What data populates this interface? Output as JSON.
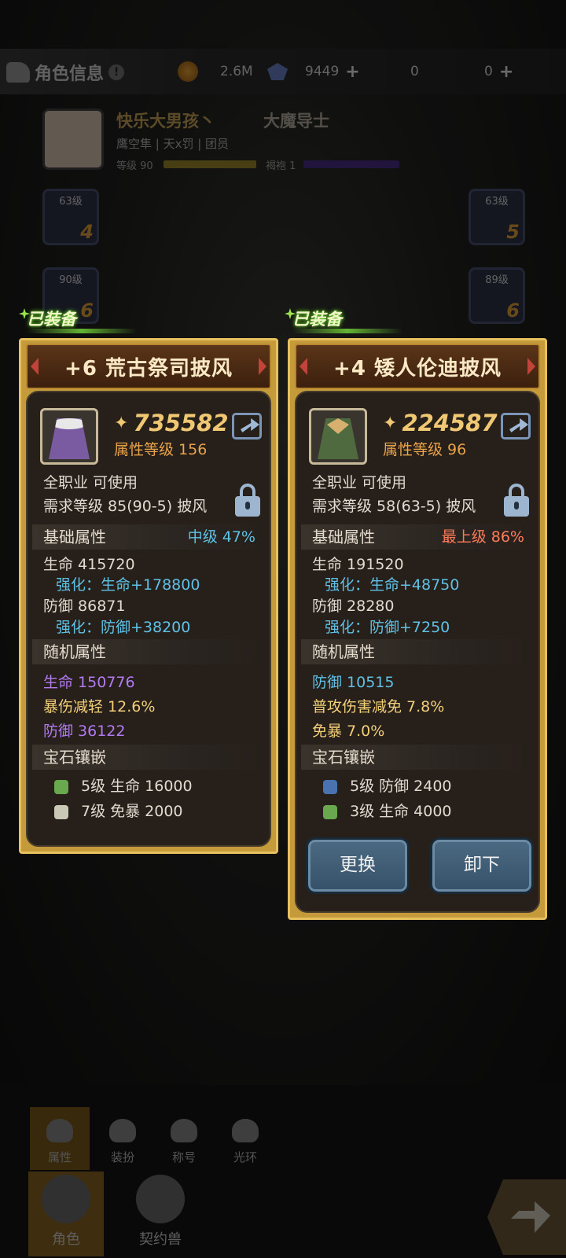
{
  "header": {
    "title": "角色信息",
    "info_mark": "!",
    "gold": "2.6M",
    "diamond": "9449",
    "ticket1": "0",
    "ticket2": "0",
    "plus": "+"
  },
  "player": {
    "name": "快乐大男孩丶",
    "class": "大魔导士",
    "title_line": "鹰空隼 | 天x罚 | 团员",
    "level_label": "等级 90",
    "cloak_label": "褐袍 1"
  },
  "slots": [
    {
      "level": "63级",
      "num": "4"
    },
    {
      "level": "90级",
      "num": "6"
    },
    {
      "level": "63级",
      "num": "5"
    },
    {
      "level": "89级",
      "num": "6"
    }
  ],
  "cards": [
    {
      "equipped_label": "已装备",
      "title": "+6 荒古祭司披风",
      "power": "735582",
      "attr_level": "属性等级 156",
      "usable": "全职业 可使用",
      "requirement": "需求等级 85(90-5)  披风",
      "base_section": "基础属性",
      "grade": "中级  47%",
      "base": [
        {
          "text": "生命  415720",
          "color": "white"
        },
        {
          "text": "强化：生命+178800",
          "color": "blue"
        },
        {
          "text": "防御  86871",
          "color": "white"
        },
        {
          "text": "强化：防御+38200",
          "color": "blue"
        }
      ],
      "random_section": "随机属性",
      "random": [
        {
          "text": "生命    150776",
          "color": "purple"
        },
        {
          "text": "暴伤减轻    12.6%",
          "color": "yellow"
        },
        {
          "text": "防御    36122",
          "color": "purple"
        }
      ],
      "gem_section": "宝石镶嵌",
      "gems": [
        {
          "text": "5级    生命 16000",
          "gem_color": "#6aa84f"
        },
        {
          "text": "7级    免暴 2000",
          "gem_color": "#c9c9b5"
        }
      ]
    },
    {
      "equipped_label": "已装备",
      "title": "+4 矮人伦迪披风",
      "power": "224587",
      "attr_level": "属性等级 96",
      "usable": "全职业 可使用",
      "requirement": "需求等级 58(63-5)  披风",
      "base_section": "基础属性",
      "grade": "最上级  86%",
      "base": [
        {
          "text": "生命  191520",
          "color": "white"
        },
        {
          "text": "强化：生命+48750",
          "color": "blue"
        },
        {
          "text": "防御  28280",
          "color": "white"
        },
        {
          "text": "强化：防御+7250",
          "color": "blue"
        }
      ],
      "random_section": "随机属性",
      "random": [
        {
          "text": "防御    10515",
          "color": "blue"
        },
        {
          "text": "普攻伤害减免    7.8%",
          "color": "yellow"
        },
        {
          "text": "免暴    7.0%",
          "color": "yellow"
        }
      ],
      "gem_section": "宝石镶嵌",
      "gems": [
        {
          "text": "5级    防御 2400",
          "gem_color": "#4a72b0"
        },
        {
          "text": "3级    生命 4000",
          "gem_color": "#6aa84f"
        }
      ],
      "buttons": {
        "replace": "更换",
        "unequip": "卸下"
      }
    }
  ],
  "sub_tabs": [
    "属性",
    "装扮",
    "称号",
    "光环"
  ],
  "main_tabs": [
    "角色",
    "契约兽"
  ]
}
